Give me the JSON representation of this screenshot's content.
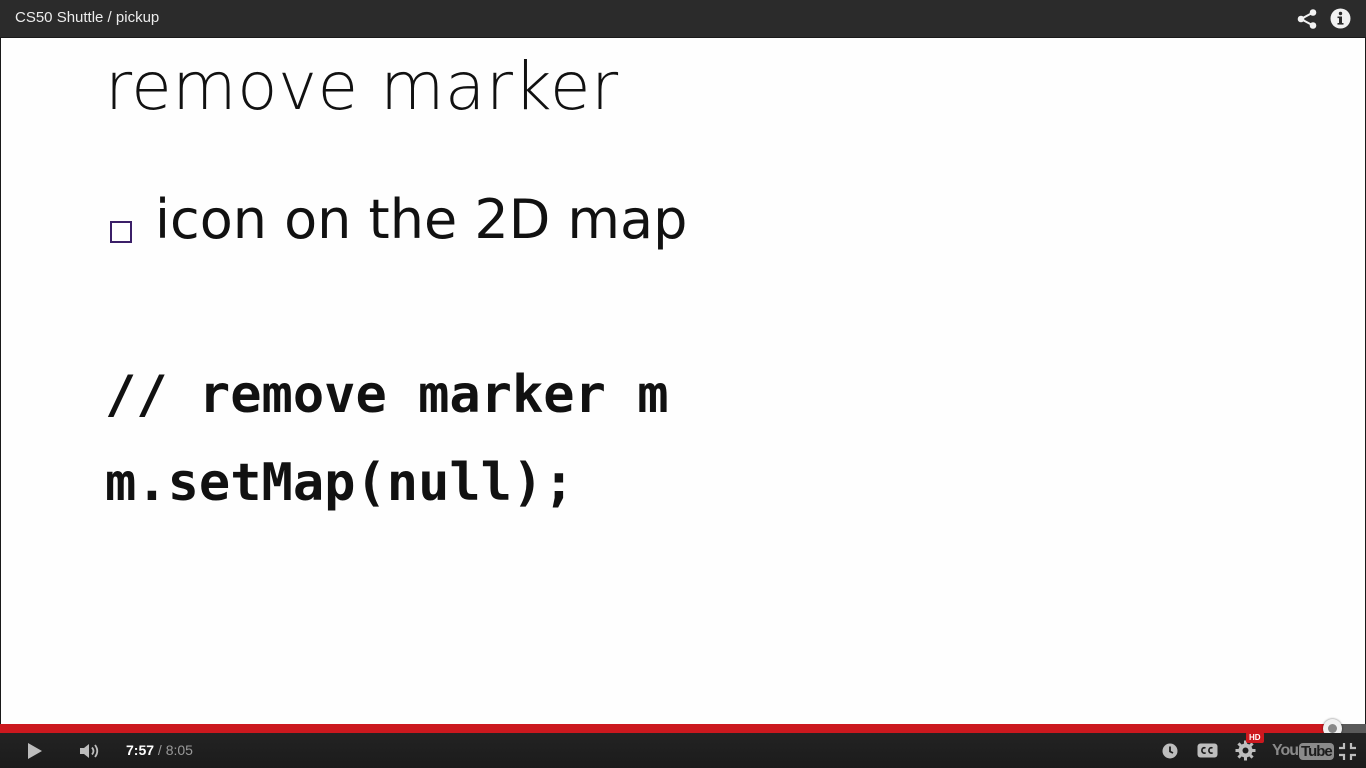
{
  "player": {
    "title": "CS50 Shuttle / pickup",
    "icons": {
      "share": "share-icon",
      "info": "info-icon"
    }
  },
  "slide": {
    "title": "remove marker",
    "bullets": [
      "icon on the 2D map"
    ],
    "code_lines": [
      "// remove marker m",
      "m.setMap(null);"
    ],
    "bullet_box_color": "#3b1f68"
  },
  "controls": {
    "current_time": "7:57",
    "time_separator": " / ",
    "duration": "8:05",
    "progress_fraction": 0.9751,
    "hd_badge": "HD",
    "logo_you": "You",
    "logo_tube": "Tube",
    "progress_color": "#cc181e",
    "icons": [
      "play-icon",
      "volume-icon",
      "watch-later-icon",
      "cc-icon",
      "settings-icon",
      "youtube-logo",
      "exit-fullscreen-icon"
    ]
  }
}
